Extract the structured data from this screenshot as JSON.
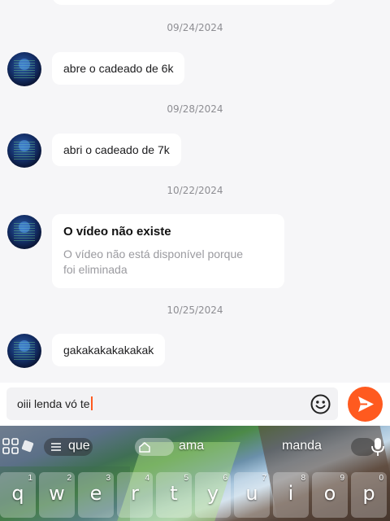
{
  "messages": [
    {
      "date": "09/24/2024",
      "text": "abre o cadeado de 6k"
    },
    {
      "date": "09/28/2024",
      "text": "abri o cadeado de 7k"
    },
    {
      "date": "10/22/2024",
      "card_title": "O vídeo não existe",
      "card_sub_line1": "O vídeo não está disponível porque",
      "card_sub_line2": "foi eliminada"
    },
    {
      "date": "10/25/2024",
      "text": "gakakakakakakak"
    }
  ],
  "input": {
    "value": "oiii lenda vó te"
  },
  "colors": {
    "accent": "#ff5a1f",
    "background": "#f6f6f8",
    "bubble": "#ffffff"
  },
  "icons": {
    "emoji": "emoji-icon",
    "send": "send-icon",
    "grid": "apps-grid-icon",
    "mic": "mic-icon"
  },
  "keyboard": {
    "suggestions": [
      "que",
      "ama",
      "manda"
    ],
    "keys": [
      {
        "letter": "q",
        "num": "1"
      },
      {
        "letter": "w",
        "num": "2"
      },
      {
        "letter": "e",
        "num": "3"
      },
      {
        "letter": "r",
        "num": "4"
      },
      {
        "letter": "t",
        "num": "5"
      },
      {
        "letter": "y",
        "num": "6"
      },
      {
        "letter": "u",
        "num": "7"
      },
      {
        "letter": "i",
        "num": "8"
      },
      {
        "letter": "o",
        "num": "9"
      },
      {
        "letter": "p",
        "num": "0"
      }
    ]
  }
}
